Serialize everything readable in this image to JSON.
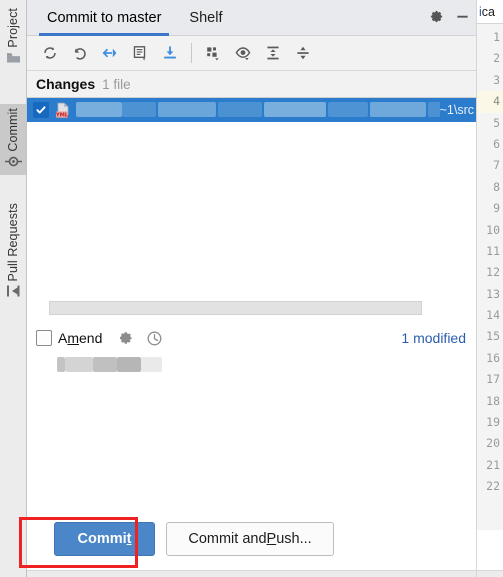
{
  "tool_strip": {
    "items": [
      {
        "label": "Project",
        "icon": "folder-icon",
        "active": false
      },
      {
        "label": "Commit",
        "icon": "commit-node-icon",
        "active": true
      },
      {
        "label": "Pull Requests",
        "icon": "pull-request-icon",
        "active": false
      }
    ]
  },
  "header": {
    "tabs": [
      {
        "label": "Commit to master",
        "active": true
      },
      {
        "label": "Shelf",
        "active": false
      }
    ],
    "actions": [
      {
        "name": "settings-icon",
        "label": "Settings"
      },
      {
        "name": "minimize-icon",
        "label": "Minimize"
      }
    ]
  },
  "toolbar": {
    "buttons": [
      {
        "name": "refresh-icon",
        "label": "Refresh Changes"
      },
      {
        "name": "rollback-icon",
        "label": "Rollback"
      },
      {
        "name": "show-diff-icon",
        "label": "Show Diff"
      },
      {
        "name": "edit-source-icon",
        "label": "Edit Source"
      },
      {
        "name": "get-from-vcs-icon",
        "label": "Update Project"
      },
      {
        "name": "group-by-icon",
        "label": "Group By"
      },
      {
        "name": "preview-diff-icon",
        "label": "Preview Diff"
      },
      {
        "name": "expand-all-icon",
        "label": "Expand All"
      },
      {
        "name": "collapse-all-icon",
        "label": "Collapse All"
      }
    ]
  },
  "changes": {
    "title": "Changes",
    "count_label": "1 file",
    "file_row": {
      "checked": true,
      "file_icon": "yml-file-icon",
      "file_icon_badge": "YML",
      "name_redacted": true,
      "path_tail": "~1\\src"
    }
  },
  "commit_area": {
    "message_value": "",
    "amend": {
      "label_prefix": "A",
      "label_mnemonic": "m",
      "label_suffix": "end",
      "checked": false
    },
    "commit_options_icon": "gear-icon",
    "commit_history_icon": "clock-icon",
    "modified_label": "1 modified",
    "author_redacted": true
  },
  "footer": {
    "commit_button": {
      "prefix": "Commi",
      "mnemonic": "t",
      "suffix": ""
    },
    "commit_and_push_button": {
      "prefix": "Commit and ",
      "mnemonic": "P",
      "suffix": "ush..."
    }
  },
  "annotation": {
    "type": "highlight-box",
    "color": "#ee2222",
    "target": "commit-button"
  },
  "editor": {
    "tab_text_1": "i",
    "tab_text_2": "ca",
    "highlighted_line": 4,
    "line_numbers": [
      1,
      2,
      3,
      4,
      5,
      6,
      7,
      8,
      9,
      10,
      11,
      12,
      13,
      14,
      15,
      16,
      17,
      18,
      19,
      20,
      21,
      22
    ]
  },
  "colors": {
    "accent_blue": "#3c76c8",
    "selection_blue": "#2b7ccc",
    "link_blue": "#2a5db0",
    "annotation_red": "#ee2222",
    "panel_gray": "#f2f2f2",
    "header_gray": "#e8eaed"
  }
}
